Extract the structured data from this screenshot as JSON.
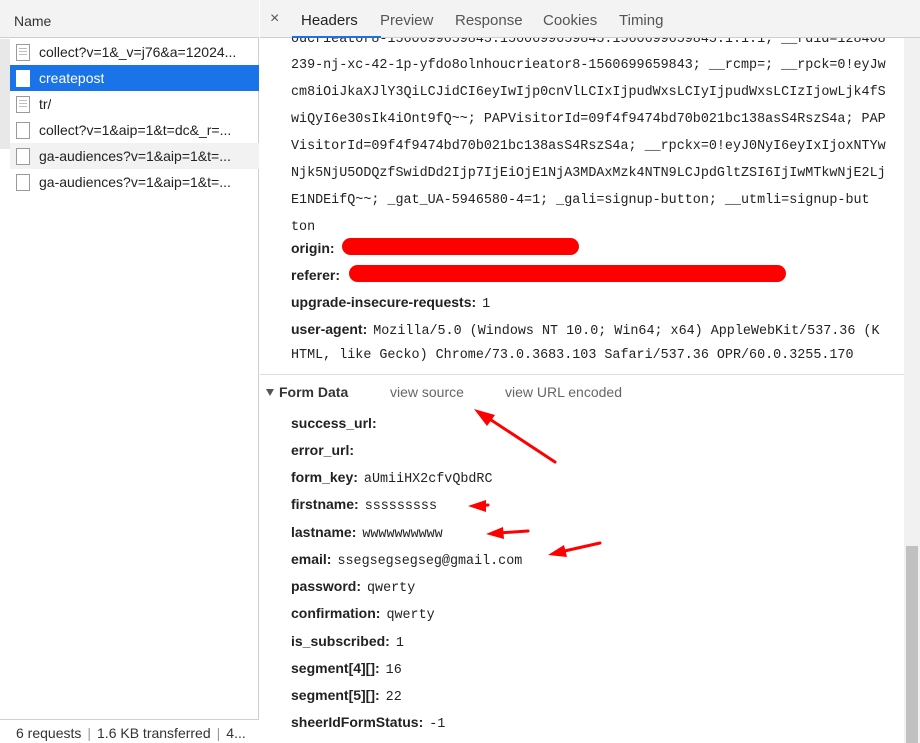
{
  "left_panel": {
    "header": "Name",
    "requests": [
      {
        "label": "collect?v=1&_v=j76&a=12024...",
        "icon": "doc-icon"
      },
      {
        "label": "createpost",
        "icon": "file-icon",
        "selected": true
      },
      {
        "label": "tr/",
        "icon": "doc-icon"
      },
      {
        "label": "collect?v=1&aip=1&t=dc&_r=...",
        "icon": "file-icon"
      },
      {
        "label": "ga-audiences?v=1&aip=1&t=...",
        "icon": "file-icon"
      },
      {
        "label": "ga-audiences?v=1&aip=1&t=...",
        "icon": "file-icon"
      }
    ],
    "status": {
      "requests": "6 requests",
      "transferred": "1.6 KB transferred",
      "more": "4..."
    }
  },
  "tabs": {
    "close": "×",
    "items": [
      "Headers",
      "Preview",
      "Response",
      "Cookies",
      "Timing"
    ],
    "active": "Headers"
  },
  "cookie_lines": [
    "oucriеator8-1560699659845.1560699659845.1560699659845.1.1.1; __rdid=128408",
    "239-nj-xc-42-1p-yfdo8olnhoucrieator8-1560699659843; __rcmp=; __rpck=0!eyJw",
    "cm8iOiJkaXJlY3QiLCJidCI6eyIwIjp0cnVlLCIxIjpudWxsLCIyIjpudWxsLCIzIjowLjk4fS",
    "wiQyI6e30sIk4iOnt9fQ~~; PAPVisitorId=09f4f9474bd70b021bc138asS4RszS4a; PAP",
    "VisitorId=09f4f9474bd70b021bc138asS4RszS4a; __rpckx=0!eyJ0NyI6eyIxIjoxNTYw",
    "Njk5NjU5ODQzfSwidDd2Ijp7IjEiOjE1NjA3MDAxMzk4NTN9LCJpdGltZSI6IjIwMTkwNjE2Lj",
    "E1NDEifQ~~; _gat_UA-5946580-4=1; _gali=signup-button; __utmli=signup-but",
    "ton"
  ],
  "headers": [
    {
      "key": "origin:",
      "value": ""
    },
    {
      "key": "referer:",
      "value": ""
    },
    {
      "key": "upgrade-insecure-requests:",
      "value": "1"
    },
    {
      "key": "user-agent:",
      "value": "Mozilla/5.0 (Windows NT 10.0; Win64; x64) AppleWebKit/537.36 (K"
    },
    {
      "key": "",
      "value": "HTML, like Gecko) Chrome/73.0.3683.103 Safari/537.36 OPR/60.0.3255.170"
    }
  ],
  "form_data": {
    "title": "Form Data",
    "view_source": "view source",
    "view_url_encoded": "view URL encoded",
    "fields": [
      {
        "key": "success_url:",
        "value": ""
      },
      {
        "key": "error_url:",
        "value": ""
      },
      {
        "key": "form_key:",
        "value": "aUmiiHX2cfvQbdRC"
      },
      {
        "key": "firstname:",
        "value": "sssssssss"
      },
      {
        "key": "lastname:",
        "value": "wwwwwwwwww"
      },
      {
        "key": "email:",
        "value": "ssegsegsegseg@gmail.com"
      },
      {
        "key": "password:",
        "value": "qwerty"
      },
      {
        "key": "confirmation:",
        "value": "qwerty"
      },
      {
        "key": "is_subscribed:",
        "value": "1"
      },
      {
        "key": "segment[4][]:",
        "value": "16"
      },
      {
        "key": "segment[5][]:",
        "value": "22"
      },
      {
        "key": "sheerIdFormStatus:",
        "value": "-1"
      }
    ]
  },
  "colors": {
    "selected_row": "#1a73e8",
    "annotation_red": "#ff0000",
    "tab_underline": "#1a73e8"
  }
}
